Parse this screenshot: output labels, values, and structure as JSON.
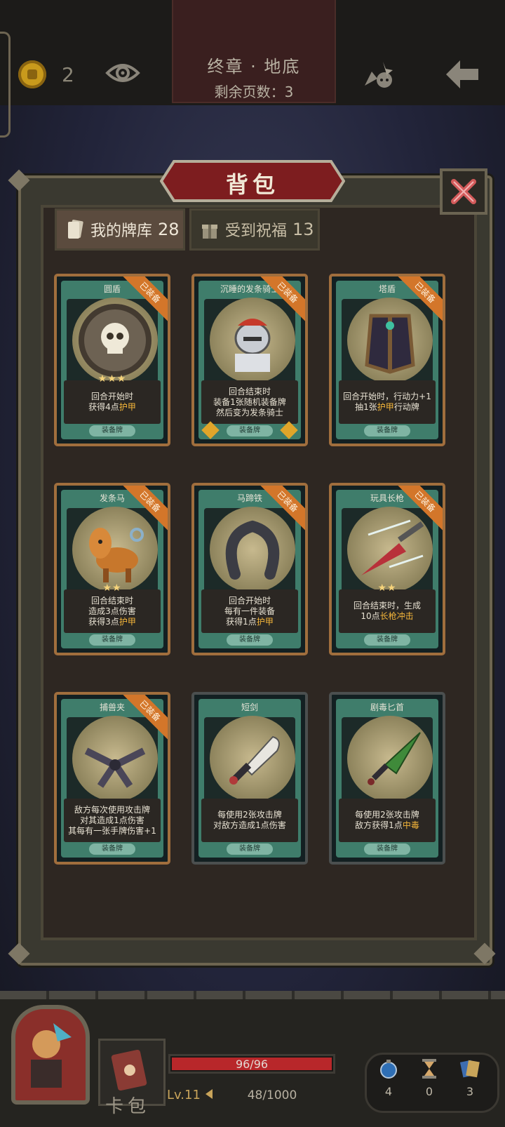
{
  "top": {
    "coins": "2",
    "chapter_title": "终章 · 地底",
    "pages_left": "剩余页数：3"
  },
  "panel": {
    "title": "背包",
    "tabs": [
      {
        "label": "我的牌库",
        "count": "28"
      },
      {
        "label": "受到祝福",
        "count": "13"
      }
    ]
  },
  "cards": [
    {
      "name": "圆盾",
      "badge": "已装备",
      "stars": "★★★",
      "lines": [
        "回合开始时",
        "获得4点护甲"
      ],
      "type": "装备牌"
    },
    {
      "name": "沉睡的发条骑士",
      "badge": "已装备",
      "stars": "",
      "lines": [
        "回合结束时",
        "装备1张随机装备牌",
        "然后变为发条骑士"
      ],
      "type": "装备牌"
    },
    {
      "name": "塔盾",
      "badge": "已装备",
      "stars": "",
      "lines": [
        "回合开始时，行动力+1",
        "抽1张护甲行动牌"
      ],
      "type": "装备牌"
    },
    {
      "name": "发条马",
      "badge": "已装备",
      "stars": "★★",
      "lines": [
        "回合结束时",
        "造成3点伤害",
        "获得3点护甲"
      ],
      "type": "装备牌"
    },
    {
      "name": "马蹄铁",
      "badge": "已装备",
      "stars": "",
      "lines": [
        "回合开始时",
        "每有一件装备",
        "获得1点护甲"
      ],
      "type": "装备牌"
    },
    {
      "name": "玩具长枪",
      "badge": "已装备",
      "stars": "★★",
      "lines": [
        "回合结束时，生成",
        "10点长枪冲击"
      ],
      "type": "装备牌"
    },
    {
      "name": "捕兽夹",
      "badge": "已装备",
      "stars": "",
      "lines": [
        "敌方每次使用攻击牌",
        "对其造成1点伤害",
        "其每有一张手牌伤害+1"
      ],
      "type": "装备牌"
    },
    {
      "name": "短剑",
      "badge": "",
      "stars": "",
      "lines": [
        "每使用2张攻击牌",
        "对敌方造成1点伤害"
      ],
      "type": "装备牌"
    },
    {
      "name": "剧毒匕首",
      "badge": "",
      "stars": "",
      "lines": [
        "每使用2张攻击牌",
        "敌方获得1点中毒"
      ],
      "type": "装备牌"
    }
  ],
  "hud": {
    "deck_label": "卡包",
    "hp": "96/96",
    "hp_fraction": 1.0,
    "level": "Lv.11",
    "xp": "48/1000",
    "resources": [
      "4",
      "0",
      "3"
    ]
  },
  "colors": {
    "equipped_ribbon": "#d3762a",
    "highlight": "#f5b63a",
    "hp": "#b8272a"
  }
}
